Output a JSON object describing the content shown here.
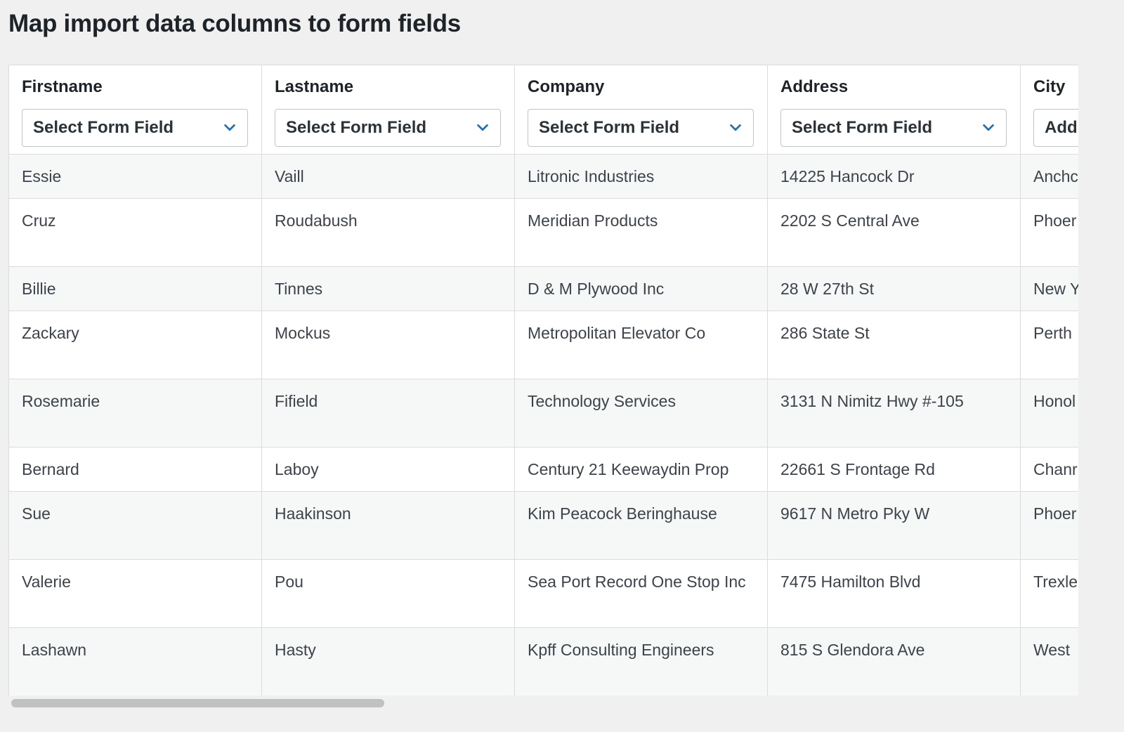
{
  "page": {
    "title": "Map import data columns to form fields"
  },
  "columns": [
    {
      "label": "Firstname",
      "select": "Select Form Field"
    },
    {
      "label": "Lastname",
      "select": "Select Form Field"
    },
    {
      "label": "Company",
      "select": "Select Form Field"
    },
    {
      "label": "Address",
      "select": "Select Form Field"
    },
    {
      "label": "City",
      "select": "Add"
    }
  ],
  "rows": [
    [
      "Essie",
      "Vaill",
      "Litronic Industries",
      "14225 Hancock Dr",
      "Anchc"
    ],
    [
      "Cruz",
      "Roudabush",
      "Meridian Products",
      "2202 S Central Ave",
      "Phoer"
    ],
    [
      "Billie",
      "Tinnes",
      "D & M Plywood Inc",
      "28 W 27th St",
      "New Y"
    ],
    [
      "Zackary",
      "Mockus",
      "Metropolitan Elevator Co",
      "286 State St",
      "Perth"
    ],
    [
      "Rosemarie",
      "Fifield",
      "Technology Services",
      "3131 N Nimitz Hwy #-105",
      "Honol"
    ],
    [
      "Bernard",
      "Laboy",
      "Century 21 Keewaydin Prop",
      "22661 S Frontage Rd",
      "Chanr"
    ],
    [
      "Sue",
      "Haakinson",
      "Kim Peacock Beringhause",
      "9617 N Metro Pky W",
      "Phoer"
    ],
    [
      "Valerie",
      "Pou",
      "Sea Port Record One Stop Inc",
      "7475 Hamilton Blvd",
      "Trexle"
    ],
    [
      "Lashawn",
      "Hasty",
      "Kpff Consulting Engineers",
      "815 S Glendora Ave",
      "West"
    ]
  ],
  "colors": {
    "accent": "#2271b1",
    "border": "#dcdcde",
    "stripe": "#f6f7f7"
  }
}
